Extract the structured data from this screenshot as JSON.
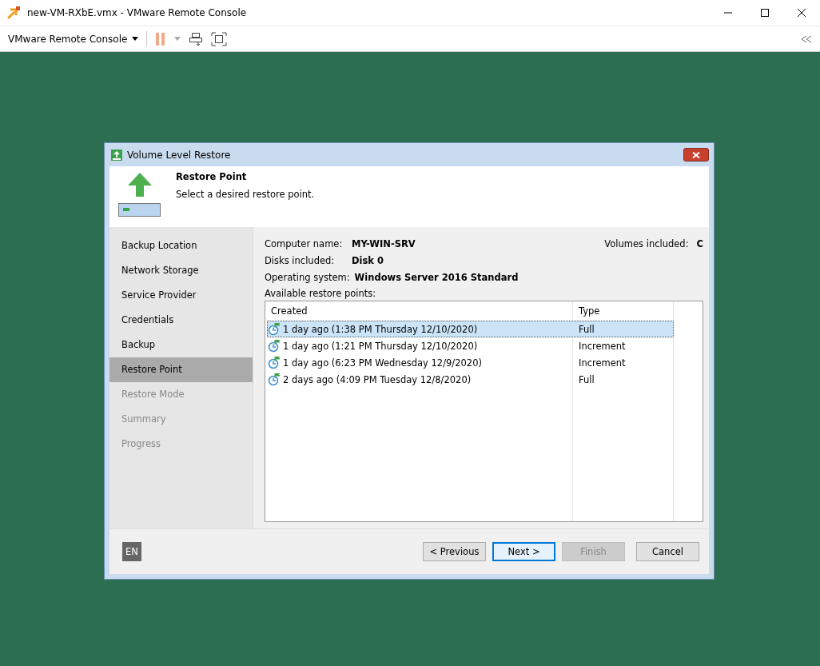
{
  "window": {
    "title": "new-VM-RXbE.vmx - VMware Remote Console"
  },
  "toolbar": {
    "menu_label": "VMware Remote Console"
  },
  "dialog": {
    "title": "Volume Level Restore",
    "step_title": "Restore Point",
    "step_description": "Select a desired restore point."
  },
  "steps": [
    {
      "label": "Backup Location",
      "selected": false,
      "disabled": false
    },
    {
      "label": "Network Storage",
      "selected": false,
      "disabled": false
    },
    {
      "label": "Service Provider",
      "selected": false,
      "disabled": false
    },
    {
      "label": "Credentials",
      "selected": false,
      "disabled": false
    },
    {
      "label": "Backup",
      "selected": false,
      "disabled": false
    },
    {
      "label": "Restore Point",
      "selected": true,
      "disabled": false
    },
    {
      "label": "Restore Mode",
      "selected": false,
      "disabled": true
    },
    {
      "label": "Summary",
      "selected": false,
      "disabled": true
    },
    {
      "label": "Progress",
      "selected": false,
      "disabled": true
    }
  ],
  "info": [
    {
      "label": "Computer name:",
      "value": "MY-WIN-SRV"
    },
    {
      "label": "Disks included:",
      "value": "Disk 0"
    },
    {
      "label": "Operating system:",
      "value": "Windows Server 2016 Standard"
    }
  ],
  "volumes": {
    "label": "Volumes included:",
    "value": "C"
  },
  "restore_points": {
    "label": "Available restore points:",
    "columns": [
      "Created",
      "Type"
    ],
    "rows": [
      {
        "created": "1 day ago (1:38 PM Thursday 12/10/2020)",
        "type": "Full",
        "selected": true
      },
      {
        "created": "1 day ago (1:21 PM Thursday 12/10/2020)",
        "type": "Increment",
        "selected": false
      },
      {
        "created": "1 day ago (6:23 PM Wednesday 12/9/2020)",
        "type": "Increment",
        "selected": false
      },
      {
        "created": "2 days ago (4:09 PM Tuesday 12/8/2020)",
        "type": "Full",
        "selected": false
      }
    ]
  },
  "language": "EN",
  "buttons": [
    {
      "label": "< Previous",
      "kind": "normal",
      "disabled": false
    },
    {
      "label": "Next >",
      "kind": "default",
      "disabled": false
    },
    {
      "label": "Finish",
      "kind": "normal",
      "disabled": true
    },
    {
      "label": "Cancel",
      "kind": "normal",
      "disabled": false
    }
  ]
}
